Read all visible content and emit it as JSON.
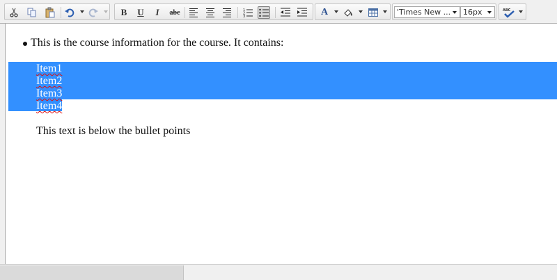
{
  "toolbar": {
    "cut": "cut",
    "copy": "copy",
    "paste": "paste",
    "undo": "undo",
    "redo": "redo",
    "bold_label": "B",
    "underline_label": "U",
    "italic_label": "I",
    "strike_label": "abc",
    "font_color_label": "A",
    "font_family": "'Times New ...",
    "font_size": "16px",
    "spellcheck_label": "ABC"
  },
  "editor": {
    "bullet_text": "This is the course information for the course. It contains:",
    "items": [
      "Item1",
      "Item2",
      "Item3",
      "Item4"
    ],
    "below_text": "This text is below the bullet points"
  },
  "colors": {
    "selection": "#3390ff",
    "toolbar_bg": "#f0f0f0",
    "spell_underline": "#dd1111"
  },
  "icons": [
    "scissors-icon",
    "copy-icon",
    "paste-icon",
    "undo-icon",
    "redo-icon",
    "bold-icon",
    "underline-icon",
    "italic-icon",
    "strikethrough-icon",
    "align-left-icon",
    "align-center-icon",
    "align-right-icon",
    "ordered-list-icon",
    "unordered-list-icon",
    "outdent-icon",
    "indent-icon",
    "font-color-icon",
    "highlight-icon",
    "table-icon",
    "spellcheck-icon"
  ]
}
